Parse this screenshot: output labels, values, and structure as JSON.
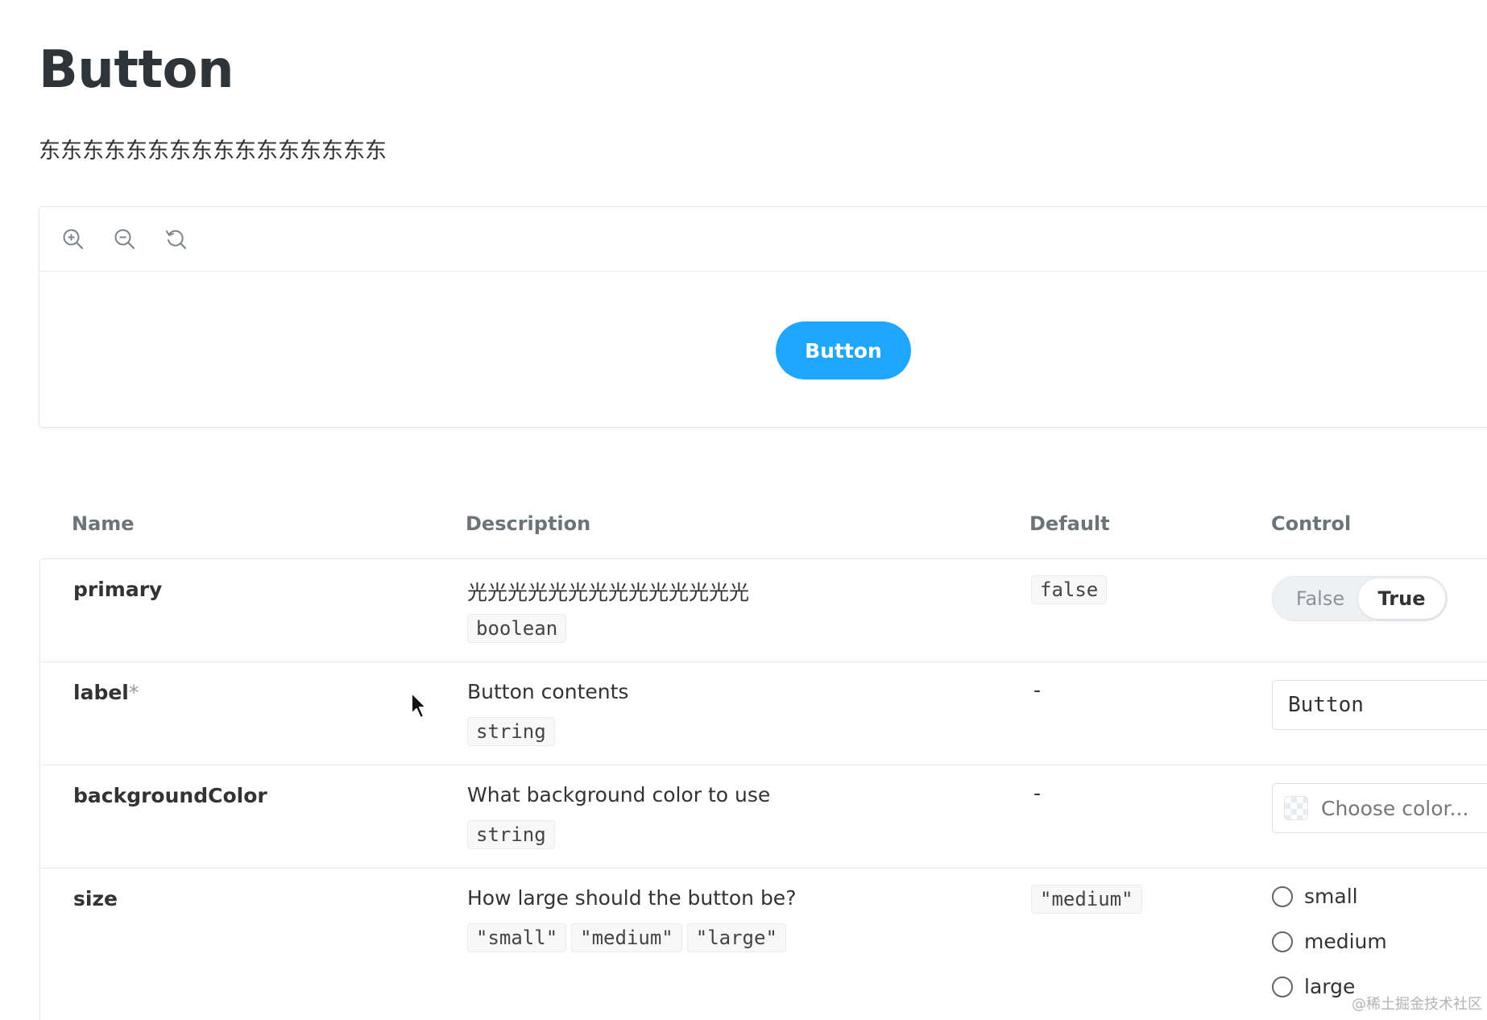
{
  "page": {
    "title": "Button",
    "subtitle": "东东东东东东东东东东东东东东东东"
  },
  "canvas": {
    "toolbar": {
      "zoom_in_icon": "zoom-in-icon",
      "zoom_out_icon": "zoom-out-icon",
      "reset_icon": "reset-zoom-icon"
    },
    "button_label": "Button",
    "button_color": "#1ea7fd"
  },
  "table": {
    "headers": {
      "name": "Name",
      "description": "Description",
      "default": "Default",
      "control": "Control"
    },
    "rows": [
      {
        "name": "primary",
        "required": "",
        "description": "光光光光光光光光光光光光光光",
        "type": "boolean",
        "default": "false",
        "control": {
          "type": "toggle",
          "false_label": "False",
          "true_label": "True",
          "selected": "True"
        }
      },
      {
        "name": "label",
        "required": "*",
        "description": "Button contents",
        "type": "string",
        "default": "-",
        "control": {
          "type": "text",
          "value": "Button"
        }
      },
      {
        "name": "backgroundColor",
        "required": "",
        "description": "What background color to use",
        "type": "string",
        "default": "-",
        "control": {
          "type": "color",
          "placeholder": "Choose color..."
        }
      },
      {
        "name": "size",
        "required": "",
        "description": "How large should the button be?",
        "type_options": [
          "\"small\"",
          "\"medium\"",
          "\"large\""
        ],
        "default": "\"medium\"",
        "control": {
          "type": "radio",
          "options": [
            "small",
            "medium",
            "large"
          ]
        }
      }
    ]
  },
  "watermark": "@稀土掘金技术社区"
}
